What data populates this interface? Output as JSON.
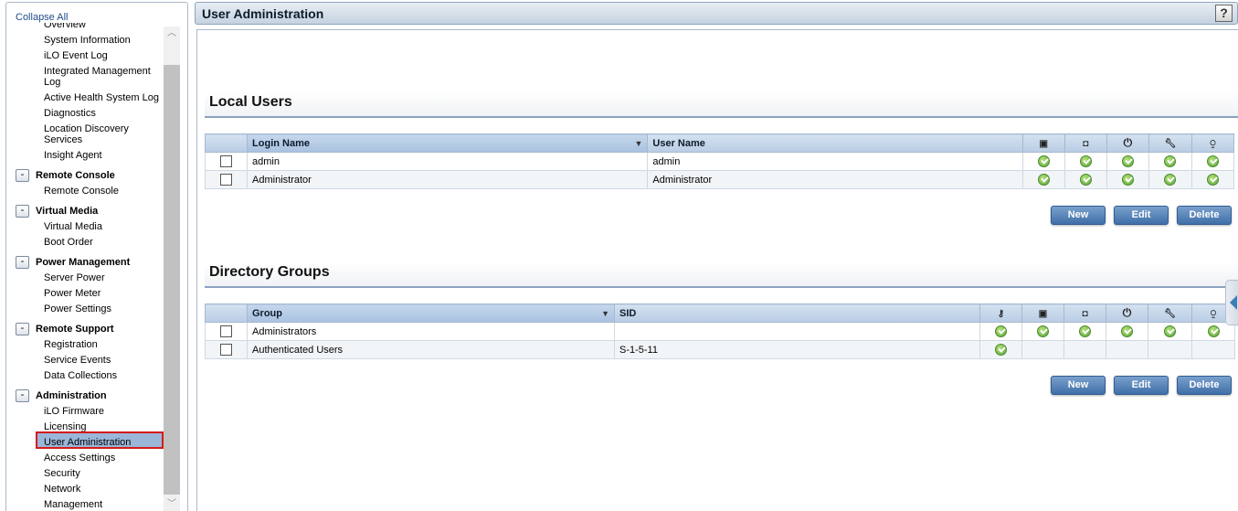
{
  "sidebar": {
    "collapse_all": "Collapse All",
    "items_top": [
      {
        "label": "Overview"
      },
      {
        "label": "System Information"
      },
      {
        "label": "iLO Event Log"
      },
      {
        "label": "Integrated Management Log"
      },
      {
        "label": "Active Health System Log"
      },
      {
        "label": "Diagnostics"
      },
      {
        "label": "Location Discovery Services"
      },
      {
        "label": "Insight Agent"
      }
    ],
    "sections": [
      {
        "title": "Remote Console",
        "toggle": "-",
        "items": [
          "Remote Console"
        ]
      },
      {
        "title": "Virtual Media",
        "toggle": "-",
        "items": [
          "Virtual Media",
          "Boot Order"
        ]
      },
      {
        "title": "Power Management",
        "toggle": "-",
        "items": [
          "Server Power",
          "Power Meter",
          "Power Settings"
        ]
      },
      {
        "title": "Remote Support",
        "toggle": "-",
        "items": [
          "Registration",
          "Service Events",
          "Data Collections"
        ]
      },
      {
        "title": "Administration",
        "toggle": "-",
        "items": [
          "iLO Firmware",
          "Licensing",
          "User Administration",
          "Access Settings",
          "Security",
          "Network",
          "Management"
        ]
      }
    ],
    "selected": "User Administration"
  },
  "header": {
    "title": "User Administration",
    "help": "?"
  },
  "local_users": {
    "title": "Local Users",
    "columns": {
      "login_name": "Login Name",
      "user_name": "User Name"
    },
    "icon_columns": [
      "remote-console-icon",
      "virtual-media-icon",
      "power-icon",
      "config-icon",
      "user-admin-icon"
    ],
    "rows": [
      {
        "login": "admin",
        "user": "admin",
        "perms": [
          true,
          true,
          true,
          true,
          true
        ]
      },
      {
        "login": "Administrator",
        "user": "Administrator",
        "perms": [
          true,
          true,
          true,
          true,
          true
        ]
      }
    ],
    "buttons": {
      "new": "New",
      "edit": "Edit",
      "delete": "Delete"
    }
  },
  "directory_groups": {
    "title": "Directory Groups",
    "columns": {
      "group": "Group",
      "sid": "SID"
    },
    "icon_columns": [
      "login-icon",
      "remote-console-icon",
      "virtual-media-icon",
      "power-icon",
      "config-icon",
      "user-admin-icon"
    ],
    "rows": [
      {
        "group": "Administrators",
        "sid": "",
        "perms": [
          true,
          true,
          true,
          true,
          true,
          true
        ]
      },
      {
        "group": "Authenticated Users",
        "sid": "S-1-5-11",
        "perms": [
          true,
          false,
          false,
          false,
          false,
          false
        ]
      }
    ],
    "buttons": {
      "new": "New",
      "edit": "Edit",
      "delete": "Delete"
    }
  },
  "colors": {
    "accent": "#3f6fa8",
    "selection_outline": "#d61a1a",
    "selected_bg": "#9ab6d8",
    "header_grad_top": "#e8edf3",
    "header_grad_bottom": "#c5d2e1"
  }
}
